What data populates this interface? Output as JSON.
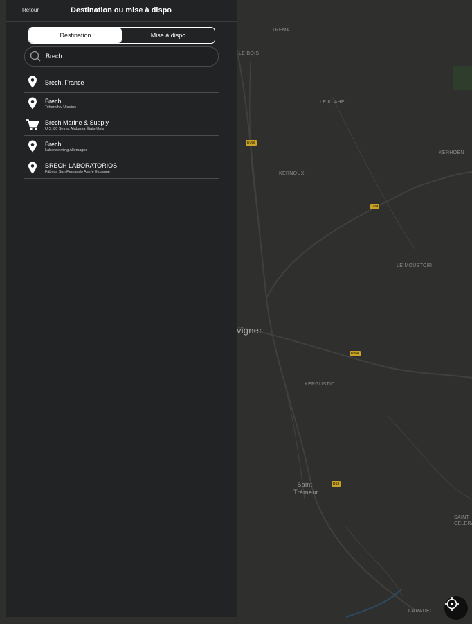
{
  "header": {
    "back_label": "Retour",
    "title": "Destination ou mise à dispo"
  },
  "segment": {
    "tabs": [
      {
        "label": "Destination",
        "active": true
      },
      {
        "label": "Mise à dispo",
        "active": false
      }
    ]
  },
  "search": {
    "value": "Brech",
    "icon": "search-icon"
  },
  "results": [
    {
      "icon": "location-pin-icon",
      "title": "Brech, France",
      "subtitle": ""
    },
    {
      "icon": "location-pin-icon",
      "title": "Brech",
      "subtitle": "Tchernihiv Ukraine"
    },
    {
      "icon": "shopping-cart-icon",
      "title": "Brech Marine & Supply",
      "subtitle": "U.S. 80 Selma Alabama États-Unis"
    },
    {
      "icon": "location-pin-icon",
      "title": "Brech",
      "subtitle": "Laberweinting Allemagne"
    },
    {
      "icon": "location-pin-icon",
      "title": "BRECH LABORATORIOS",
      "subtitle": "Fábrica San Fernando Atarfe Espagne"
    }
  ],
  "map": {
    "places": {
      "p1": "TREMAT",
      "p2": "LE BOIS",
      "p3": "LE KLAHE",
      "p4": "KERNOUX",
      "p5": "KERHOEN",
      "p6": "LE MOUSTOIR",
      "p7": "vigner",
      "p8": "KERGUSTIC",
      "p9": "Saint-",
      "p10": "Trémeur",
      "p11": "SAINT-",
      "p12": "CELERAIN",
      "p13": "CARADEC"
    },
    "roads": {
      "r1": "D768",
      "r2": "D19",
      "r3": "D768",
      "r4": "D19"
    },
    "locate_icon": "crosshair-icon"
  }
}
